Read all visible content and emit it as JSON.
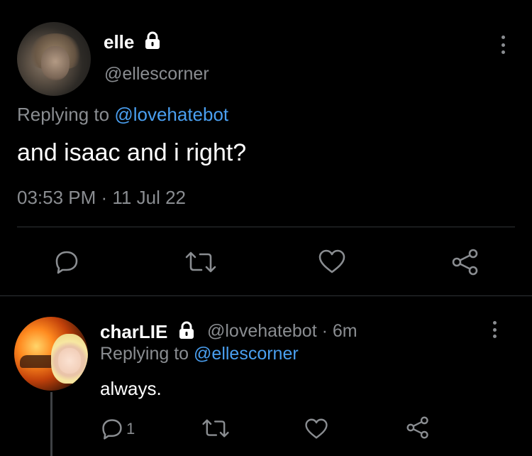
{
  "main_tweet": {
    "display_name": "elle",
    "handle": "@ellescorner",
    "replying_prefix": "Replying to ",
    "replying_to": "@lovehatebot",
    "text": "and isaac and i right?",
    "timestamp": "03:53 PM · 11 Jul 22",
    "icons": [
      "reply-icon",
      "retweet-icon",
      "like-icon",
      "share-icon",
      "lock-icon",
      "more-icon"
    ]
  },
  "reply_tweet": {
    "display_name": "charLIE",
    "handle_meta": "@lovehatebot · 6m",
    "replying_prefix": "Replying to ",
    "replying_to": "@ellescorner",
    "text": "always.",
    "reply_count": "1",
    "icons": [
      "reply-icon",
      "retweet-icon",
      "like-icon",
      "share-icon",
      "lock-icon",
      "more-icon"
    ]
  },
  "colors": {
    "background": "#000000",
    "text": "#ffffff",
    "secondary_text": "#8a8d91",
    "mention": "#4a9ff0",
    "divider": "#2f3336"
  }
}
